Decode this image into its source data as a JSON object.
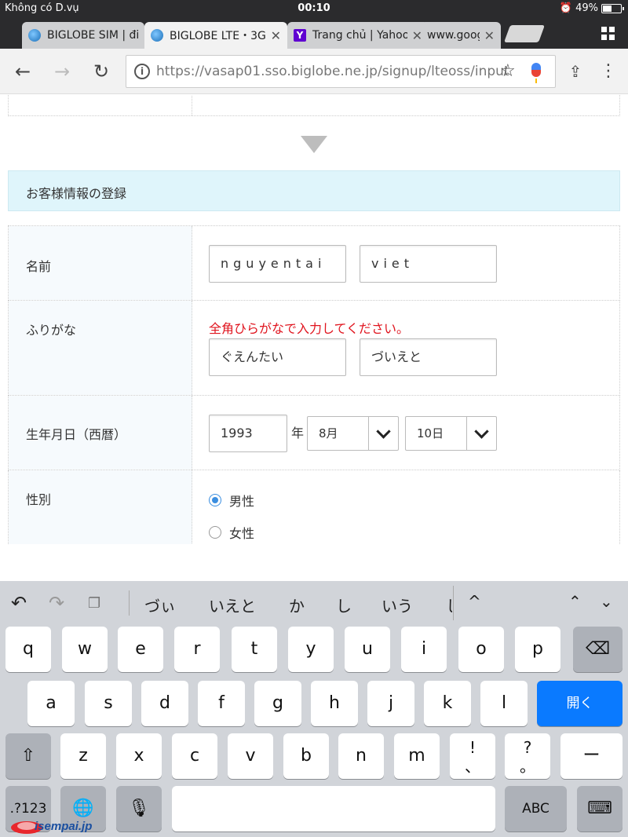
{
  "status": {
    "carrier": "Không có D.vụ",
    "time": "00:10",
    "battery": "49%",
    "battery_level": 0.49
  },
  "tabs": [
    {
      "title": "BIGLOBE SIM | điệ",
      "icon": "biglobe-icon"
    },
    {
      "title": "BIGLOBE LTE・3G",
      "icon": "biglobe-icon"
    },
    {
      "title": "Trang chủ | Yahoo",
      "icon": "yahoo-icon"
    },
    {
      "title": "www.goog"
    }
  ],
  "toolbar": {
    "url_host": "https://vasap01.sso.biglobe.ne.jp",
    "url_path": "/signup/lteoss/input"
  },
  "form": {
    "section_title": "お客様情報の登録",
    "name_label": "名前",
    "name_last": "nguyentai",
    "name_first": "viet",
    "furigana_label": "ふりがな",
    "furigana_note": "全角ひらがなで入力してください。",
    "furigana_last": "ぐえんたい",
    "furigana_first": "づいえと",
    "birth_label": "生年月日（西暦）",
    "birth_year": "1993",
    "year_suffix": "年",
    "birth_month": "8月",
    "birth_day": "10日",
    "gender_label": "性別",
    "gender_male": "男性",
    "gender_female": "女性"
  },
  "keyboard": {
    "suggestions": [
      "づぃ",
      "いえと",
      "か",
      "し",
      "いう",
      "し"
    ],
    "row1": [
      "q",
      "w",
      "e",
      "r",
      "t",
      "y",
      "u",
      "i",
      "o",
      "p"
    ],
    "row2": [
      "a",
      "s",
      "d",
      "f",
      "g",
      "h",
      "j",
      "k",
      "l"
    ],
    "row3": [
      "z",
      "x",
      "c",
      "v",
      "b",
      "n",
      "m"
    ],
    "open_key": "開く",
    "excl_top": "!",
    "excl_bottom": "、",
    "question_top": "?",
    "question_bottom": "。",
    "dash_key": "ー",
    "numbers_key": ".?123",
    "abc_key": "ABC"
  },
  "watermark": {
    "text": "isempai.jp"
  }
}
